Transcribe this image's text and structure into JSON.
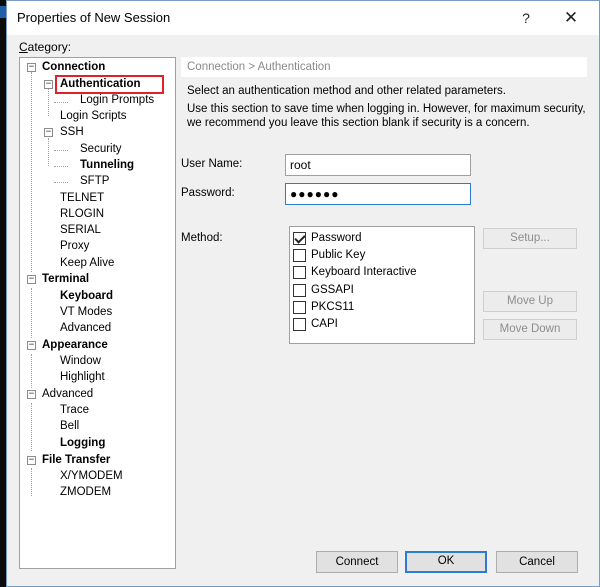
{
  "window": {
    "title": "Properties of New Session",
    "help_label": "?",
    "close_label": "✕"
  },
  "category_label_underlined": "C",
  "category_label_rest": "ategory:",
  "tree": {
    "connection": "Connection",
    "authentication": "Authentication",
    "login_prompts": "Login Prompts",
    "login_scripts": "Login Scripts",
    "ssh": "SSH",
    "security": "Security",
    "tunneling": "Tunneling",
    "sftp": "SFTP",
    "telnet": "TELNET",
    "rlogin": "RLOGIN",
    "serial": "SERIAL",
    "proxy": "Proxy",
    "keep_alive": "Keep Alive",
    "terminal": "Terminal",
    "keyboard": "Keyboard",
    "vt_modes": "VT Modes",
    "advanced_terminal": "Advanced",
    "appearance": "Appearance",
    "window": "Window",
    "highlight": "Highlight",
    "advanced": "Advanced",
    "trace": "Trace",
    "bell": "Bell",
    "logging": "Logging",
    "file_transfer": "File Transfer",
    "xymodem": "X/YMODEM",
    "zmodem": "ZMODEM"
  },
  "panel": {
    "heading": "Connection > Authentication",
    "desc1": "Select an authentication method and other related parameters.",
    "desc2a": "Use this section to save time when logging in. However, for maximum security,",
    "desc2b": "we recommend you leave this section blank if security is a concern.",
    "user_name_label": "User Name:",
    "user_name_value": "root",
    "password_label": "Password:",
    "password_value": "●●●●●●",
    "method_label": "Method:",
    "methods": [
      {
        "label": "Password",
        "checked": true
      },
      {
        "label": "Public Key",
        "checked": false
      },
      {
        "label": "Keyboard Interactive",
        "checked": false
      },
      {
        "label": "GSSAPI",
        "checked": false
      },
      {
        "label": "PKCS11",
        "checked": false
      },
      {
        "label": "CAPI",
        "checked": false
      }
    ],
    "setup_label": "Setup...",
    "move_up_label": "Move Up",
    "move_down_label": "Move Down"
  },
  "buttons": {
    "connect": "Connect",
    "ok": "OK",
    "cancel": "Cancel"
  },
  "colors": {
    "accent": "#2e7bd1",
    "highlight_box": "#e0202a"
  }
}
